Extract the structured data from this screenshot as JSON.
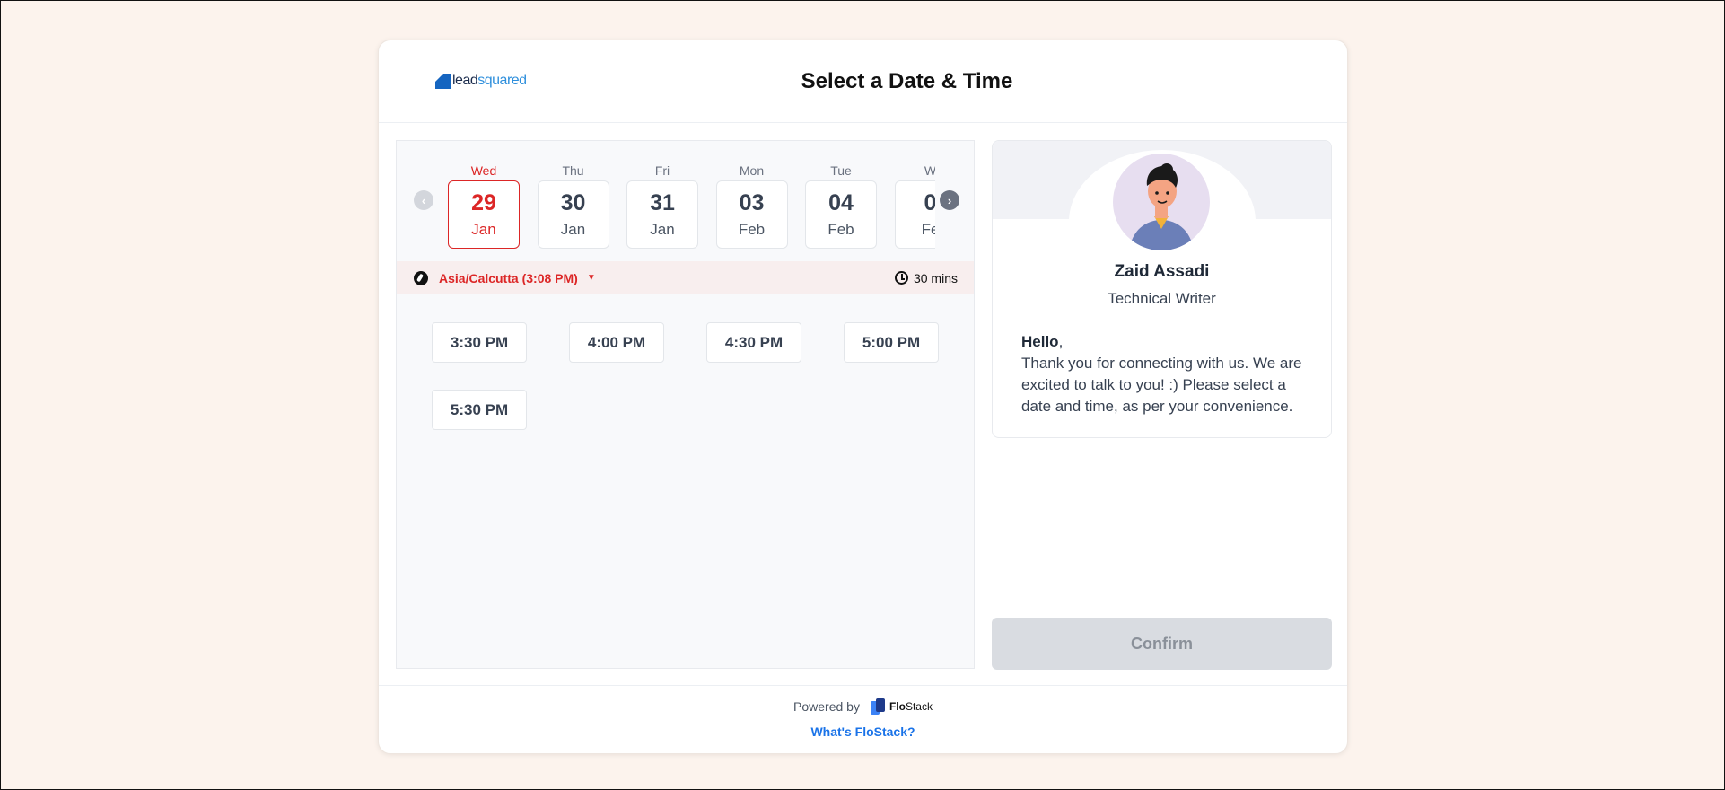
{
  "header": {
    "logo_part1": "lead",
    "logo_part2": "squared",
    "title": "Select a Date & Time"
  },
  "calendar": {
    "days": [
      {
        "name": "Wed",
        "num": "29",
        "month": "Jan",
        "selected": true
      },
      {
        "name": "Thu",
        "num": "30",
        "month": "Jan",
        "selected": false
      },
      {
        "name": "Fri",
        "num": "31",
        "month": "Jan",
        "selected": false
      },
      {
        "name": "Mon",
        "num": "03",
        "month": "Feb",
        "selected": false
      },
      {
        "name": "Tue",
        "num": "04",
        "month": "Feb",
        "selected": false
      },
      {
        "name": "W",
        "num": "0",
        "month": "Fe",
        "selected": false
      }
    ],
    "prev_icon": "chevron-left-icon",
    "next_icon": "chevron-right-icon"
  },
  "timezone": {
    "label": "Asia/Calcutta (3:08 PM)",
    "duration": "30 mins"
  },
  "slots": [
    "3:30 PM",
    "4:00 PM",
    "4:30 PM",
    "5:00 PM",
    "5:30 PM"
  ],
  "profile": {
    "name": "Zaid Assadi",
    "role": "Technical Writer",
    "greeting": "Hello",
    "greeting_punct": ",",
    "message": "Thank you for connecting with us. We are excited to talk to you! :) Please select a date and time, as per your convenience."
  },
  "confirm_label": "Confirm",
  "footer": {
    "powered_by": "Powered by",
    "brand_bold": "Flo",
    "brand_rest": "Stack",
    "whats_link": "What's FloStack?"
  },
  "colors": {
    "accent": "#dc2626",
    "link": "#1a73e8",
    "page_bg": "#fcf3ed"
  }
}
